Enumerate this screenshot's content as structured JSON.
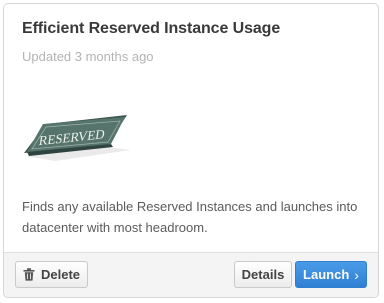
{
  "card": {
    "title": "Efficient Reserved Instance Usage",
    "updated": "Updated 3 months ago",
    "image_text": "RESERVED",
    "description": "Finds any available Reserved Instances and launches into datacenter with most headroom."
  },
  "actions": {
    "delete_label": "Delete",
    "details_label": "Details",
    "launch_label": "Launch",
    "launch_icon": "chevron-right-icon",
    "delete_icon": "trash-icon"
  },
  "colors": {
    "primary": "#2f80d4",
    "title": "#3a3a3a",
    "muted": "#b3b3b3",
    "sign": "#4e6b63"
  }
}
